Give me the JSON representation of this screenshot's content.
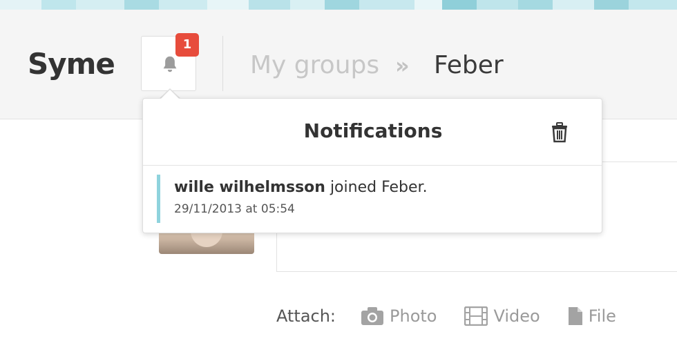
{
  "header": {
    "brand": "Syme",
    "notifications_count": "1",
    "breadcrumb": {
      "groups_label": "My groups",
      "separator": "»",
      "current": "Feber"
    }
  },
  "notifications": {
    "title": "Notifications",
    "items": [
      {
        "user": "wille wilhelmsson",
        "action": " joined Feber.",
        "time": "29/11/2013 at 05:54"
      }
    ]
  },
  "composer": {
    "attach_label": "Attach:",
    "photo_label": "Photo",
    "video_label": "Video",
    "file_label": "File"
  },
  "icons": {
    "bell": "bell-icon",
    "trash": "trash-icon",
    "camera": "camera-icon",
    "film": "film-icon",
    "file": "file-icon"
  },
  "colors": {
    "badge": "#e74c3c",
    "accent": "#8fd3dd"
  }
}
